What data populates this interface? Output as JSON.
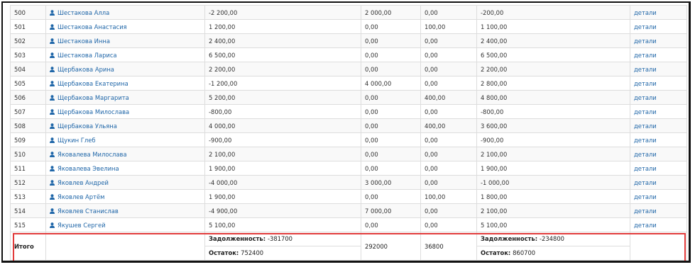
{
  "rows": [
    {
      "id": "500",
      "name": "Шестакова Алла",
      "c1": "-2 200,00",
      "c2": "2 000,00",
      "c3": "0,00",
      "c4": "-200,00",
      "link": "детали"
    },
    {
      "id": "501",
      "name": "Шестакова Анастасия",
      "c1": "1 200,00",
      "c2": "0,00",
      "c3": "100,00",
      "c4": "1 100,00",
      "link": "детали"
    },
    {
      "id": "502",
      "name": "Шестакова Инна",
      "c1": "2 400,00",
      "c2": "0,00",
      "c3": "0,00",
      "c4": "2 400,00",
      "link": "детали"
    },
    {
      "id": "503",
      "name": "Шестакова Лариса",
      "c1": "6 500,00",
      "c2": "0,00",
      "c3": "0,00",
      "c4": "6 500,00",
      "link": "детали"
    },
    {
      "id": "504",
      "name": "Щербакова Арина",
      "c1": "2 200,00",
      "c2": "0,00",
      "c3": "0,00",
      "c4": "2 200,00",
      "link": "детали"
    },
    {
      "id": "505",
      "name": "Щербакова Екатерина",
      "c1": "-1 200,00",
      "c2": "4 000,00",
      "c3": "0,00",
      "c4": "2 800,00",
      "link": "детали"
    },
    {
      "id": "506",
      "name": "Щербакова Маргарита",
      "c1": "5 200,00",
      "c2": "0,00",
      "c3": "400,00",
      "c4": "4 800,00",
      "link": "детали"
    },
    {
      "id": "507",
      "name": "Щербакова Милослава",
      "c1": "-800,00",
      "c2": "0,00",
      "c3": "0,00",
      "c4": "-800,00",
      "link": "детали"
    },
    {
      "id": "508",
      "name": "Щербакова Ульяна",
      "c1": "4 000,00",
      "c2": "0,00",
      "c3": "400,00",
      "c4": "3 600,00",
      "link": "детали"
    },
    {
      "id": "509",
      "name": "Щукин Глеб",
      "c1": "-900,00",
      "c2": "0,00",
      "c3": "0,00",
      "c4": "-900,00",
      "link": "детали"
    },
    {
      "id": "510",
      "name": "Яковалева Милослава",
      "c1": "2 100,00",
      "c2": "0,00",
      "c3": "0,00",
      "c4": "2 100,00",
      "link": "детали"
    },
    {
      "id": "511",
      "name": "Яковалева Эвелина",
      "c1": "1 900,00",
      "c2": "0,00",
      "c3": "0,00",
      "c4": "1 900,00",
      "link": "детали"
    },
    {
      "id": "512",
      "name": "Яковлев Андрей",
      "c1": "-4 000,00",
      "c2": "3 000,00",
      "c3": "0,00",
      "c4": "-1 000,00",
      "link": "детали"
    },
    {
      "id": "513",
      "name": "Яковлев Артём",
      "c1": "1 900,00",
      "c2": "0,00",
      "c3": "100,00",
      "c4": "1 800,00",
      "link": "детали"
    },
    {
      "id": "514",
      "name": "Яковлев Станислав",
      "c1": "-4 900,00",
      "c2": "7 000,00",
      "c3": "0,00",
      "c4": "2 100,00",
      "link": "детали"
    },
    {
      "id": "515",
      "name": "Якушев Сергей",
      "c1": "5 100,00",
      "c2": "0,00",
      "c3": "0,00",
      "c4": "5 100,00",
      "link": "детали"
    }
  ],
  "totals": {
    "label": "Итого",
    "debt_label": "Задолженность:",
    "debt_start": "-381700",
    "balance_label": "Остаток:",
    "balance_start": "752400",
    "col2": "292000",
    "col3": "36800",
    "debt_end": "-234800",
    "balance_end": "860700"
  },
  "icons": {
    "user": "user-icon"
  },
  "colors": {
    "link": "#1f66a8",
    "highlight": "#e23b3b"
  }
}
